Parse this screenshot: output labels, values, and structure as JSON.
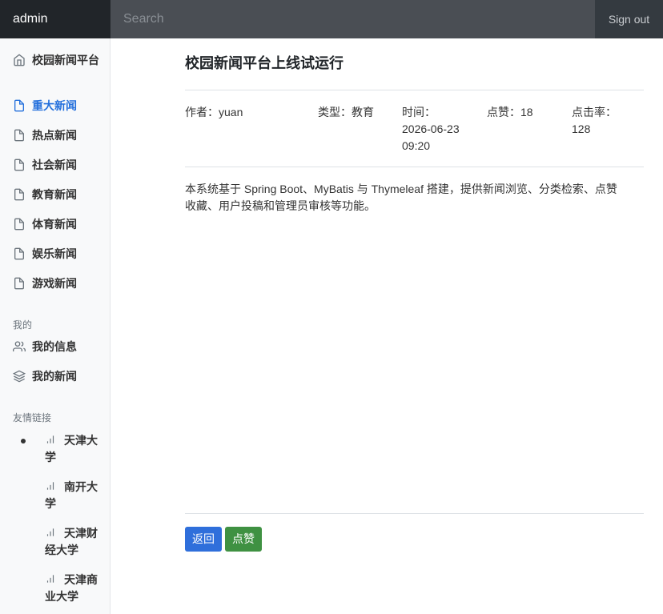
{
  "header": {
    "brand": "admin",
    "search_placeholder": "Search",
    "signout_label": "Sign out"
  },
  "sidebar": {
    "items": [
      {
        "label": "校园新闻平台",
        "icon": "home-icon",
        "active": false
      },
      {
        "label": "重大新闻",
        "icon": "file-icon",
        "active": true
      },
      {
        "label": "热点新闻",
        "icon": "file-icon",
        "active": false
      },
      {
        "label": "社会新闻",
        "icon": "file-icon",
        "active": false
      },
      {
        "label": "教育新闻",
        "icon": "file-icon",
        "active": false
      },
      {
        "label": "体育新闻",
        "icon": "file-icon",
        "active": false
      },
      {
        "label": "娱乐新闻",
        "icon": "file-icon",
        "active": false
      },
      {
        "label": "游戏新闻",
        "icon": "file-icon",
        "active": false
      }
    ],
    "mine_heading": "我的",
    "mine_items": [
      {
        "label": "我的信息",
        "icon": "users-icon"
      },
      {
        "label": "我的新闻",
        "icon": "layers-icon"
      }
    ],
    "links_heading": "友情链接",
    "links": [
      {
        "label": "天津大学",
        "icon": "bar-chart-icon"
      },
      {
        "label": "南开大学",
        "icon": "bar-chart-icon"
      },
      {
        "label": "天津财经大学",
        "icon": "bar-chart-icon"
      },
      {
        "label": "天津商业大学",
        "icon": "bar-chart-icon"
      }
    ],
    "accent_color": "#2470dc"
  },
  "article": {
    "title": "校园新闻平台上线试运行",
    "author": "作者：yuan",
    "type": "类型：教育",
    "time": "时间：2026-06-23 09:20",
    "likes": "点赞：18",
    "clicks": "点击率：128",
    "body": "本系统基于 Spring Boot、MyBatis 与 Thymeleaf 搭建，提供新闻浏览、分类检索、点赞收藏、用户投稿和管理员审核等功能。"
  },
  "actions": {
    "back_label": "返回",
    "like_label": "点赞",
    "back_color": "#2f6fdb",
    "like_color": "#3f9142"
  }
}
